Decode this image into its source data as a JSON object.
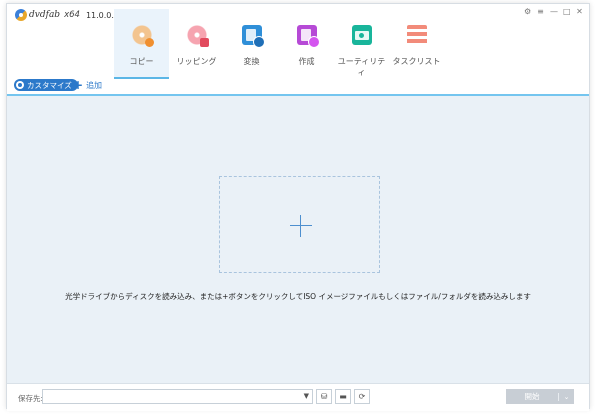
{
  "app": {
    "brand": "dvdfab",
    "arch": "x64",
    "version": "11.0.0.1"
  },
  "window_controls": [
    "⚙",
    "≡",
    "—",
    "□",
    "✕"
  ],
  "nav": {
    "tabs": [
      {
        "label": "コピー",
        "icon": "copy-disc-icon",
        "active": true
      },
      {
        "label": "リッピング",
        "icon": "ripper-disc-icon",
        "active": false
      },
      {
        "label": "変換",
        "icon": "converter-film-icon",
        "active": false
      },
      {
        "label": "作成",
        "icon": "creator-film-icon",
        "active": false
      },
      {
        "label": "ユーティリティ",
        "icon": "utilities-folder-icon",
        "active": false
      },
      {
        "label": "タスクリスト",
        "icon": "task-list-icon",
        "active": false
      }
    ]
  },
  "toolbar": {
    "customize_label": "カスタマイズ",
    "add_label": "追加",
    "accent": "#2c79ca"
  },
  "main": {
    "hint": "光学ドライブからディスクを読み込み、または+ボタンをクリックしてISO イメージファイルもしくはファイル/フォルダを読み込みします"
  },
  "bottom": {
    "save_label": "保存先:",
    "save_value": "",
    "start_label": "開始"
  }
}
